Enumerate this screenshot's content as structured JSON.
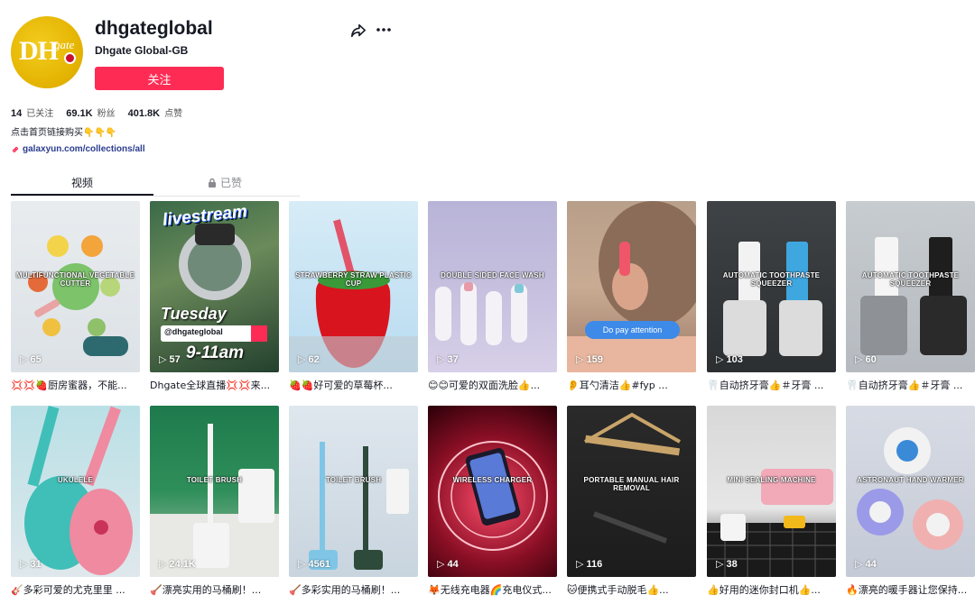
{
  "profile": {
    "username": "dhgateglobal",
    "nickname": "Dhgate Global-GB",
    "follow_label": "关注",
    "avatar_text": "DH",
    "avatar_sub": "gate",
    "stats": [
      {
        "value": "14",
        "label": "已关注"
      },
      {
        "value": "69.1K",
        "label": "粉丝"
      },
      {
        "value": "401.8K",
        "label": "点赞"
      }
    ],
    "bio": "点击首页链接购买👇👇👇",
    "link": "galaxyun.com/collections/all"
  },
  "tabs": {
    "videos": "视频",
    "liked": "已赞"
  },
  "videos": [
    {
      "overlay": "MULTIFUNCTIONAL VEGETABLE CUTTER",
      "plays": "65",
      "caption": "💢💢🍓厨房蜜器，不能..."
    },
    {
      "overlay": "",
      "plays": "57",
      "caption": "Dhgate全球直播💢💢来..."
    },
    {
      "overlay": "STRAWBERRY STRAW PLASTIC CUP",
      "plays": "62",
      "caption": "🍓🍓好可爱的草莓杯..."
    },
    {
      "overlay": "DOUBLE SIDED FACE WASH",
      "plays": "37",
      "caption": "😊😊可爱的双面洗脸👍..."
    },
    {
      "overlay": "",
      "plays": "159",
      "caption": "👂耳勺清洁👍#fyp ..."
    },
    {
      "overlay": "AUTOMATIC TOOTHPASTE SQUEEZER",
      "plays": "103",
      "caption": "🦷自动挤牙膏👍＃牙膏 ..."
    },
    {
      "overlay": "AUTOMATIC TOOTHPASTE SQUEEZER",
      "plays": "60",
      "caption": "🦷自动挤牙膏👍＃牙膏 ..."
    },
    {
      "overlay": "UKULELE",
      "plays": "31",
      "caption": "🎸多彩可爱的尤克里里 ..."
    },
    {
      "overlay": "TOILET BRUSH",
      "plays": "24.1K",
      "caption": "🪠漂亮实用的马桶刷！..."
    },
    {
      "overlay": "TOILET BRUSH",
      "plays": "4561",
      "caption": "🪠多彩实用的马桶刷！..."
    },
    {
      "overlay": "WIRELESS CHARGER",
      "plays": "44",
      "caption": "🦊无线充电器🌈充电仪式..."
    },
    {
      "overlay": "PORTABLE MANUAL HAIR REMOVAL",
      "plays": "116",
      "caption": "🐱便携式手动脱毛👍..."
    },
    {
      "overlay": "MINI SEALING MACHINE",
      "plays": "38",
      "caption": "👍好用的迷你封口机👍..."
    },
    {
      "overlay": "ASTRONAUT HAND WARMER",
      "plays": "44",
      "caption": "🔥漂亮的暖手器让您保持..."
    }
  ],
  "thumb_texts": {
    "livestream": "livestream",
    "tuesday": "Tuesday",
    "handle": "@dhgateglobal",
    "time": "9-11am",
    "pay_attention": "Do pay attention"
  }
}
